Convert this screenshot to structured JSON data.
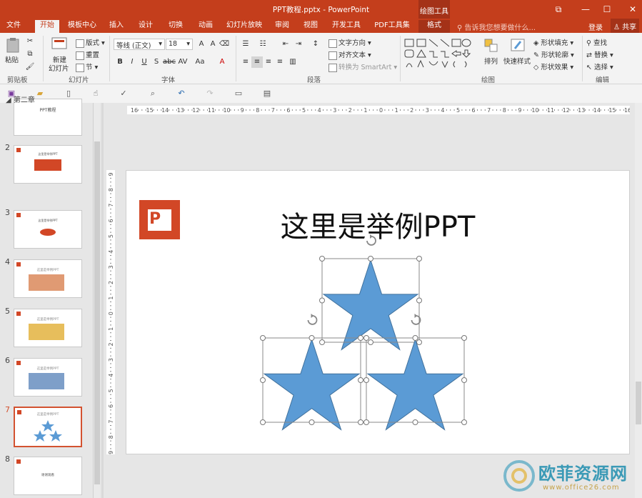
{
  "titlebar": {
    "doc_title": "PPT教程.pptx - PowerPoint",
    "context_group": "绘图工具",
    "restore": "⧉",
    "minimize": "—",
    "maximize": "☐",
    "close": "✕"
  },
  "tabs": [
    {
      "label": "文件"
    },
    {
      "label": "开始"
    },
    {
      "label": "模板中心"
    },
    {
      "label": "插入"
    },
    {
      "label": "设计"
    },
    {
      "label": "切换"
    },
    {
      "label": "动画"
    },
    {
      "label": "幻灯片放映"
    },
    {
      "label": "审阅"
    },
    {
      "label": "视图"
    },
    {
      "label": "开发工具"
    },
    {
      "label": "PDF工具集"
    },
    {
      "label": "格式"
    }
  ],
  "tell_me": "告诉我您想要做什么...",
  "signin": "登录",
  "share": "共享",
  "ribbon": {
    "clipboard": {
      "paste": "粘贴",
      "label": "剪贴板"
    },
    "slides": {
      "new_slide_1": "新建",
      "new_slide_2": "幻灯片",
      "layout": "版式",
      "reset": "重置",
      "section": "节",
      "label": "幻灯片"
    },
    "font": {
      "font_name": "等线 (正文)",
      "font_size": "18",
      "label": "字体"
    },
    "paragraph": {
      "text_direction": "文字方向",
      "align_text": "对齐文本",
      "smartart": "转换为 SmartArt",
      "label": "段落"
    },
    "drawing": {
      "arrange": "排列",
      "quick_styles": "快速样式",
      "fill": "形状填充",
      "outline": "形状轮廓",
      "effects": "形状效果",
      "label": "绘图"
    },
    "editing": {
      "find": "查找",
      "replace": "替换",
      "select": "选择",
      "label": "编辑"
    }
  },
  "thumbnails": {
    "section_label": "第二章",
    "slide_nums": [
      "2",
      "3",
      "4",
      "5",
      "6",
      "7",
      "8"
    ],
    "slide1_text": "PPT教程",
    "slide2_text": "这里是举例PPT",
    "slide3_text": "这里是举例PPT",
    "slide4_text": "这里是举例PPT",
    "slide5_text": "这里是举例PPT",
    "slide6_text": "这里是举例PPT",
    "slide7_text": "这里是举例PPT",
    "slide8_text": "谢谢观看"
  },
  "slide": {
    "title": "这里是举例PPT",
    "shape_fill": "#5b9bd5",
    "shape_outline": "#41719c"
  },
  "ruler": {
    "h_ticks": [
      "16",
      "15",
      "14",
      "13",
      "12",
      "11",
      "10",
      "9",
      "8",
      "7",
      "6",
      "5",
      "4",
      "3",
      "2",
      "1",
      "0",
      "1",
      "2",
      "3",
      "4",
      "5",
      "6",
      "7",
      "8",
      "9",
      "10",
      "11",
      "12",
      "13",
      "14",
      "15",
      "16"
    ],
    "v_ticks": [
      "9",
      "8",
      "7",
      "6",
      "5",
      "4",
      "3",
      "2",
      "1",
      "0",
      "1",
      "2",
      "3",
      "4",
      "5",
      "6",
      "7",
      "8",
      "9"
    ]
  },
  "watermark": {
    "brand": "欧菲资源网",
    "url": "www.office26.com"
  },
  "colors": {
    "accent": "#c43e1c",
    "selected_border": "#d35230"
  }
}
